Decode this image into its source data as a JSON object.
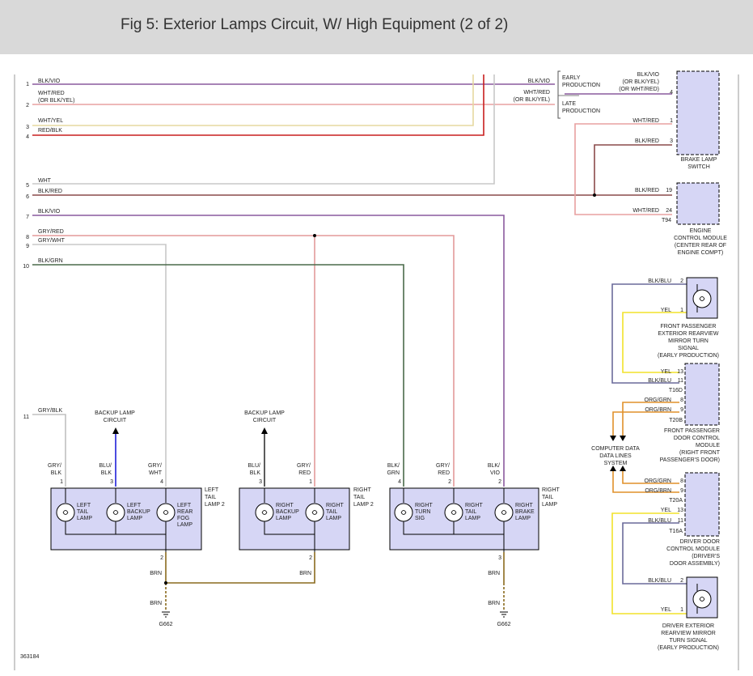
{
  "header": {
    "title": "Fig 5: Exterior Lamps Circuit, W/ High Equipment (2 of 2)"
  },
  "colors": {
    "vio": "#8a5a9e",
    "wht_red": "#e8a0a0",
    "wht_yel": "#e6d9a0",
    "red": "#c81e1e",
    "wht": "#c8c8c8",
    "blk_red": "#8a4a4a",
    "gry_red": "#e39a9a",
    "gry": "#c0c0c0",
    "blk_grn": "#4a6a4a",
    "brn": "#8a6a1e",
    "yel": "#f2e22a",
    "blk_blu": "#6a6a9a",
    "org": "#e0902a",
    "blu_blk": "#1f1fd9",
    "component_fill": "#d6d6f5"
  },
  "diagram_id": "363184",
  "harness_wires": [
    {
      "pin": "1",
      "label": "BLK/VIO"
    },
    {
      "pin": "2",
      "label": "WHT/RED\n(OR BLK/YEL)"
    },
    {
      "pin": "3",
      "label": "WHT/YEL"
    },
    {
      "pin": "4",
      "label": "RED/BLK"
    },
    {
      "pin": "5",
      "label": "WHT"
    },
    {
      "pin": "6",
      "label": "BLK/RED"
    },
    {
      "pin": "7",
      "label": "BLK/VIO"
    },
    {
      "pin": "8",
      "label": "GRY/RED"
    },
    {
      "pin": "9",
      "label": "GRY/WHT"
    },
    {
      "pin": "10",
      "label": "BLK/GRN"
    },
    {
      "pin": "11",
      "label": "GRY/BLK"
    }
  ],
  "brake_switch": {
    "early": "EARLY\nPRODUCTION",
    "late": "LATE\nPRODUCTION",
    "wire_top": "BLK/VIO\n(OR BLK/YEL)\n(OR WHT/RED)",
    "pin_top": "4",
    "wire_right_1": "BLK/VIO",
    "wire_right_2": "WHT/RED\n(OR BLK/YEL)",
    "wire_p1": "WHT/RED",
    "pin_p1": "1",
    "wire_p3": "BLK/RED",
    "pin_p3": "3",
    "name": "BRAKE LAMP\nSWITCH"
  },
  "ecm": {
    "wire_a": "BLK/RED",
    "pin_a": "19",
    "wire_b": "WHT/RED",
    "pin_b": "24",
    "connector": "T94",
    "name": "ENGINE\nCONTROL MODULE\n(CENTER REAR OF\nENGINE COMPT)"
  },
  "fp_mirror": {
    "wire_a": "BLK/BLU",
    "pin_a": "2",
    "wire_b": "YEL",
    "pin_b": "1",
    "name": "FRONT PASSENGER\nEXTERIOR REARVIEW\nMIRROR TURN\nSIGNAL\n(EARLY PRODUCTION)"
  },
  "fp_door": {
    "wire_a": "YEL",
    "pin_a": "13",
    "wire_b": "BLK/BLU",
    "pin_b": "11",
    "conn_1": "T16D",
    "wire_c": "ORG/GRN",
    "pin_c": "8",
    "wire_d": "ORG/BRN",
    "pin_d": "9",
    "conn_2": "T20B",
    "name": "FRONT PASSENGER\nDOOR CONTROL\nMODULE\n(RIGHT FRONT\nPASSENGER'S DOOR)"
  },
  "data_lines": "COMPUTER DATA\nDATA LINES\nSYSTEM",
  "dr_door": {
    "wire_a": "ORG/GRN",
    "pin_a": "8",
    "wire_b": "ORG/BRN",
    "pin_b": "9",
    "conn_1": "T20A",
    "wire_c": "YEL",
    "pin_c": "13",
    "wire_d": "BLK/BLU",
    "pin_d": "11",
    "conn_2": "T16A",
    "name": "DRIVER DOOR\nCONTROL MODULE\n(DRIVER'S\nDOOR ASSEMBLY)"
  },
  "dr_mirror": {
    "wire_a": "BLK/BLU",
    "pin_a": "2",
    "wire_b": "YEL",
    "pin_b": "1",
    "name": "DRIVER EXTERIOR\nREARVIEW MIRROR\nTURN SIGNAL\n(EARLY PRODUCTION)"
  },
  "backup_circuit_label": "BACKUP LAMP\nCIRCUIT",
  "lamp_groups": [
    {
      "name": "LEFT\nTAIL\nLAMP 2",
      "ground_pin": "2",
      "pins": [
        {
          "num": "1",
          "wire": "GRY/\nBLK",
          "lamp": "LEFT\nTAIL\nLAMP"
        },
        {
          "num": "3",
          "wire": "BLU/\nBLK",
          "lamp": "LEFT\nBACKUP\nLAMP"
        },
        {
          "num": "4",
          "wire": "GRY/\nWHT",
          "lamp": "LEFT\nREAR\nFOG\nLAMP"
        }
      ]
    },
    {
      "name": "RIGHT\nTAIL\nLAMP 2",
      "ground_pin": "2",
      "pins": [
        {
          "num": "3",
          "wire": "BLU/\nBLK",
          "lamp": "RIGHT\nBACKUP\nLAMP"
        },
        {
          "num": "1",
          "wire": "GRY/\nRED",
          "lamp": "RIGHT\nTAIL\nLAMP"
        }
      ]
    },
    {
      "name": "RIGHT\nTAIL\nLAMP",
      "ground_pin": "3",
      "pins": [
        {
          "num": "4",
          "wire": "BLK/\nGRN",
          "lamp": "RIGHT\nTURN\nSIG"
        },
        {
          "num": "2",
          "wire": "GRY/\nRED",
          "lamp": "RIGHT\nTAIL\nLAMP"
        },
        {
          "num": "2",
          "wire": "BLK/\nVIO",
          "lamp": "RIGHT\nBRAKE\nLAMP"
        }
      ]
    }
  ],
  "grounds": {
    "wire": "BRN",
    "left_ground": "G662",
    "right_ground": "G662"
  }
}
